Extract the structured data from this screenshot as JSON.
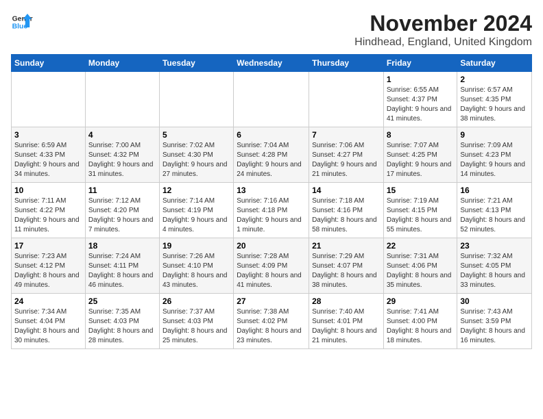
{
  "logo": {
    "general": "General",
    "blue": "Blue"
  },
  "header": {
    "month_year": "November 2024",
    "location": "Hindhead, England, United Kingdom"
  },
  "days_of_week": [
    "Sunday",
    "Monday",
    "Tuesday",
    "Wednesday",
    "Thursday",
    "Friday",
    "Saturday"
  ],
  "weeks": [
    [
      {
        "day": "",
        "detail": ""
      },
      {
        "day": "",
        "detail": ""
      },
      {
        "day": "",
        "detail": ""
      },
      {
        "day": "",
        "detail": ""
      },
      {
        "day": "",
        "detail": ""
      },
      {
        "day": "1",
        "detail": "Sunrise: 6:55 AM\nSunset: 4:37 PM\nDaylight: 9 hours\nand 41 minutes."
      },
      {
        "day": "2",
        "detail": "Sunrise: 6:57 AM\nSunset: 4:35 PM\nDaylight: 9 hours\nand 38 minutes."
      }
    ],
    [
      {
        "day": "3",
        "detail": "Sunrise: 6:59 AM\nSunset: 4:33 PM\nDaylight: 9 hours\nand 34 minutes."
      },
      {
        "day": "4",
        "detail": "Sunrise: 7:00 AM\nSunset: 4:32 PM\nDaylight: 9 hours\nand 31 minutes."
      },
      {
        "day": "5",
        "detail": "Sunrise: 7:02 AM\nSunset: 4:30 PM\nDaylight: 9 hours\nand 27 minutes."
      },
      {
        "day": "6",
        "detail": "Sunrise: 7:04 AM\nSunset: 4:28 PM\nDaylight: 9 hours\nand 24 minutes."
      },
      {
        "day": "7",
        "detail": "Sunrise: 7:06 AM\nSunset: 4:27 PM\nDaylight: 9 hours\nand 21 minutes."
      },
      {
        "day": "8",
        "detail": "Sunrise: 7:07 AM\nSunset: 4:25 PM\nDaylight: 9 hours\nand 17 minutes."
      },
      {
        "day": "9",
        "detail": "Sunrise: 7:09 AM\nSunset: 4:23 PM\nDaylight: 9 hours\nand 14 minutes."
      }
    ],
    [
      {
        "day": "10",
        "detail": "Sunrise: 7:11 AM\nSunset: 4:22 PM\nDaylight: 9 hours\nand 11 minutes."
      },
      {
        "day": "11",
        "detail": "Sunrise: 7:12 AM\nSunset: 4:20 PM\nDaylight: 9 hours\nand 7 minutes."
      },
      {
        "day": "12",
        "detail": "Sunrise: 7:14 AM\nSunset: 4:19 PM\nDaylight: 9 hours\nand 4 minutes."
      },
      {
        "day": "13",
        "detail": "Sunrise: 7:16 AM\nSunset: 4:18 PM\nDaylight: 9 hours\nand 1 minute."
      },
      {
        "day": "14",
        "detail": "Sunrise: 7:18 AM\nSunset: 4:16 PM\nDaylight: 8 hours\nand 58 minutes."
      },
      {
        "day": "15",
        "detail": "Sunrise: 7:19 AM\nSunset: 4:15 PM\nDaylight: 8 hours\nand 55 minutes."
      },
      {
        "day": "16",
        "detail": "Sunrise: 7:21 AM\nSunset: 4:13 PM\nDaylight: 8 hours\nand 52 minutes."
      }
    ],
    [
      {
        "day": "17",
        "detail": "Sunrise: 7:23 AM\nSunset: 4:12 PM\nDaylight: 8 hours\nand 49 minutes."
      },
      {
        "day": "18",
        "detail": "Sunrise: 7:24 AM\nSunset: 4:11 PM\nDaylight: 8 hours\nand 46 minutes."
      },
      {
        "day": "19",
        "detail": "Sunrise: 7:26 AM\nSunset: 4:10 PM\nDaylight: 8 hours\nand 43 minutes."
      },
      {
        "day": "20",
        "detail": "Sunrise: 7:28 AM\nSunset: 4:09 PM\nDaylight: 8 hours\nand 41 minutes."
      },
      {
        "day": "21",
        "detail": "Sunrise: 7:29 AM\nSunset: 4:07 PM\nDaylight: 8 hours\nand 38 minutes."
      },
      {
        "day": "22",
        "detail": "Sunrise: 7:31 AM\nSunset: 4:06 PM\nDaylight: 8 hours\nand 35 minutes."
      },
      {
        "day": "23",
        "detail": "Sunrise: 7:32 AM\nSunset: 4:05 PM\nDaylight: 8 hours\nand 33 minutes."
      }
    ],
    [
      {
        "day": "24",
        "detail": "Sunrise: 7:34 AM\nSunset: 4:04 PM\nDaylight: 8 hours\nand 30 minutes."
      },
      {
        "day": "25",
        "detail": "Sunrise: 7:35 AM\nSunset: 4:03 PM\nDaylight: 8 hours\nand 28 minutes."
      },
      {
        "day": "26",
        "detail": "Sunrise: 7:37 AM\nSunset: 4:03 PM\nDaylight: 8 hours\nand 25 minutes."
      },
      {
        "day": "27",
        "detail": "Sunrise: 7:38 AM\nSunset: 4:02 PM\nDaylight: 8 hours\nand 23 minutes."
      },
      {
        "day": "28",
        "detail": "Sunrise: 7:40 AM\nSunset: 4:01 PM\nDaylight: 8 hours\nand 21 minutes."
      },
      {
        "day": "29",
        "detail": "Sunrise: 7:41 AM\nSunset: 4:00 PM\nDaylight: 8 hours\nand 18 minutes."
      },
      {
        "day": "30",
        "detail": "Sunrise: 7:43 AM\nSunset: 3:59 PM\nDaylight: 8 hours\nand 16 minutes."
      }
    ]
  ]
}
